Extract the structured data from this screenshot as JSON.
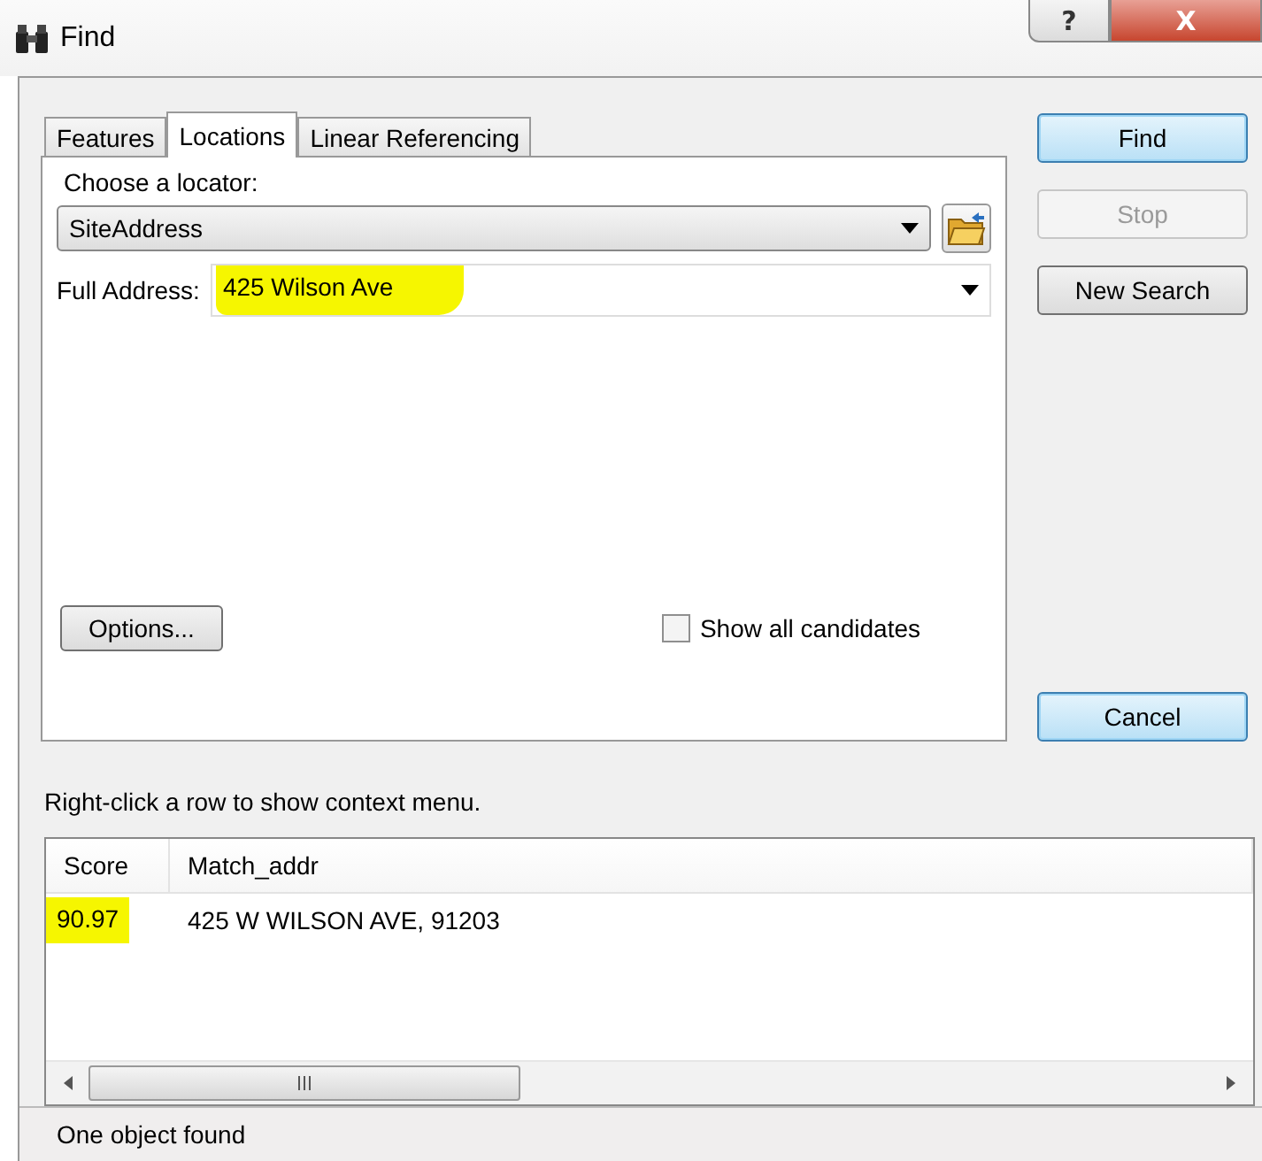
{
  "window": {
    "title": "Find",
    "buttons": [
      {
        "kind": "help",
        "label": "?"
      },
      {
        "kind": "close",
        "label": "X"
      }
    ]
  },
  "tabs": [
    {
      "label": "Features",
      "selected": false
    },
    {
      "label": "Locations",
      "selected": true
    },
    {
      "label": "Linear Referencing",
      "selected": false
    }
  ],
  "locator": {
    "label": "Choose a locator:",
    "value": "SiteAddress"
  },
  "address": {
    "label": "Full Address:",
    "value": "425 Wilson Ave",
    "highlighted": true
  },
  "options_button": "Options...",
  "show_all_candidates": {
    "label": "Show all candidates",
    "checked": false
  },
  "side_buttons": [
    {
      "label": "Find",
      "disabled": false,
      "default": true
    },
    {
      "label": "Stop",
      "disabled": true,
      "default": false
    },
    {
      "label": "New Search",
      "disabled": false,
      "default": false
    }
  ],
  "cancel_button": {
    "label": "Cancel",
    "default": true
  },
  "hint": "Right-click a row to show context menu.",
  "table": {
    "columns": [
      "Score",
      "Match_addr"
    ],
    "rows": [
      {
        "cells": [
          "90.97",
          "425 W WILSON AVE, 91203"
        ],
        "highlighted": true
      }
    ]
  },
  "status_bar": "One object found"
}
